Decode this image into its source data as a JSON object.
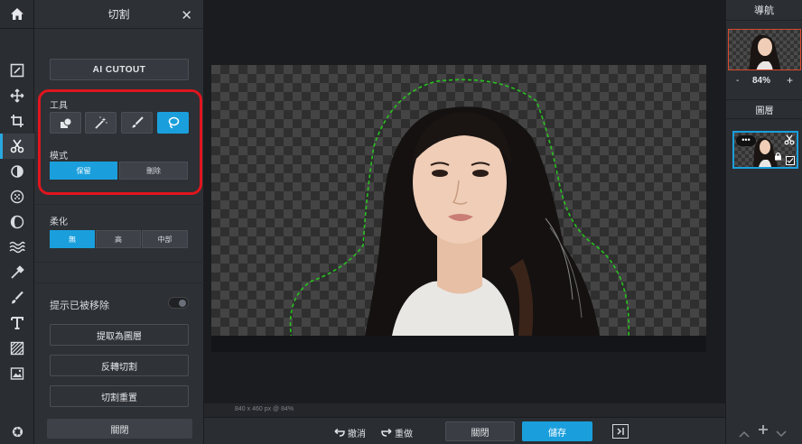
{
  "rail": {
    "icons": [
      "home-icon",
      "edit-icon",
      "move-icon",
      "crop-icon",
      "scissors-icon",
      "adjust-icon",
      "effects-icon",
      "filter-icon",
      "wave-icon",
      "dropper-icon",
      "brush-icon",
      "text-icon",
      "texture-icon",
      "image-icon",
      "settings-icon"
    ]
  },
  "panel": {
    "title": "切割",
    "close_glyph": "✕",
    "ai_cutout_label": "AI CUTOUT",
    "tools_label": "工具",
    "mode_label": "模式",
    "mode_options": [
      "保留",
      "刪除"
    ],
    "mode_selected": "保留",
    "feather_label": "柔化",
    "feather_options": [
      "無",
      "高",
      "中部"
    ],
    "feather_selected": "無",
    "show_removed_label": "提示已被移除",
    "show_removed_on": false,
    "extract_layer_label": "提取為圖層",
    "invert_label": "反轉切割",
    "reset_label": "切割重置",
    "close_label": "關閉"
  },
  "canvas": {
    "status": "840 x 460 px @ 84%"
  },
  "bottom": {
    "undo_label": "撤消",
    "redo_label": "重做",
    "close_label": "關閉",
    "save_label": "儲存"
  },
  "right": {
    "navigator_title": "導航",
    "zoom_minus": "-",
    "zoom_value": "84%",
    "zoom_plus": "+",
    "layers_title": "圖層",
    "layer_menu": "•••"
  },
  "colors": {
    "accent": "#1a9fdc",
    "highlight": "#e0151e",
    "lasso": "#27c21f",
    "nav_border": "#d8482b"
  }
}
